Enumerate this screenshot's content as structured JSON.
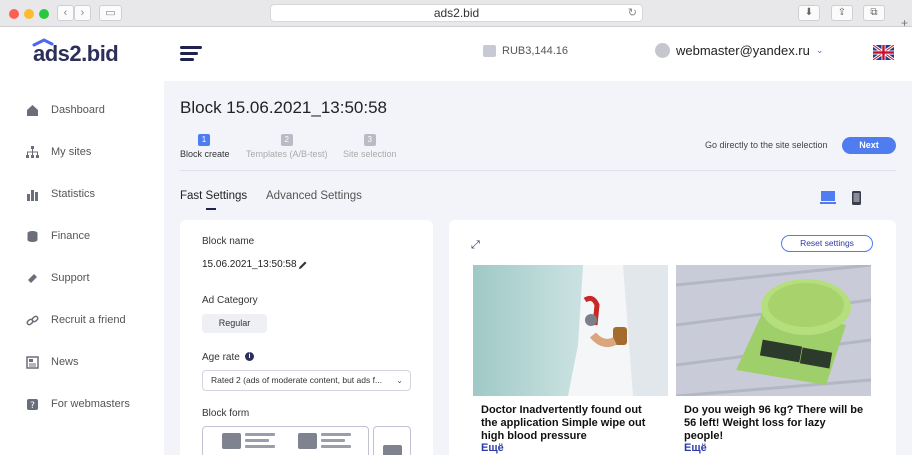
{
  "browser": {
    "url": "ads2.bid"
  },
  "header": {
    "logo": "ads2.bid",
    "balance": "RUB3,144.16",
    "user": "webmaster@yandex.ru"
  },
  "sidebar": {
    "items": [
      {
        "label": "Dashboard",
        "icon": "home-icon"
      },
      {
        "label": "My sites",
        "icon": "sitemap-icon"
      },
      {
        "label": "Statistics",
        "icon": "bar-chart-icon"
      },
      {
        "label": "Finance",
        "icon": "coins-icon"
      },
      {
        "label": "Support",
        "icon": "ticket-icon"
      },
      {
        "label": "Recruit a friend",
        "icon": "chain-icon"
      },
      {
        "label": "News",
        "icon": "newspaper-icon"
      },
      {
        "label": "For webmasters",
        "icon": "question-icon"
      }
    ]
  },
  "main": {
    "title": "Block 15.06.2021_13:50:58",
    "steps": [
      {
        "num": "1",
        "label": "Block create"
      },
      {
        "num": "2",
        "label": "Templates (A/B-test)"
      },
      {
        "num": "3",
        "label": "Site selection"
      }
    ],
    "goto_text": "Go directly to the site selection",
    "next_label": "Next",
    "tabs": [
      "Fast Settings",
      "Advanced Settings"
    ]
  },
  "settings": {
    "block_name_label": "Block name",
    "block_name_value": "15.06.2021_13:50:58",
    "ad_category_label": "Ad Category",
    "ad_category_value": "Regular",
    "age_rate_label": "Age rate",
    "age_rate_value": "Rated 2 (ads of moderate content, but ads f...",
    "block_form_label": "Block form"
  },
  "preview": {
    "reset_label": "Reset settings",
    "ads": [
      {
        "title": "Doctor Inadvertently found out the application Simple wipe out high blood pressure",
        "more": "Ещё"
      },
      {
        "title": "Do you weigh 96 kg? There will be 56 left! Weight loss for lazy people!",
        "more": "Ещё"
      }
    ]
  },
  "colors": {
    "accent": "#4f7df0",
    "brand_dark": "#2c2f5a",
    "background": "#f3f4f9"
  }
}
